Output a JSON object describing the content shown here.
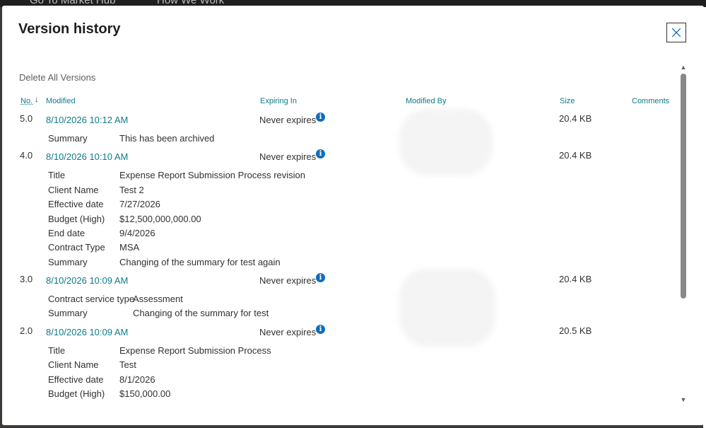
{
  "backdrop": {
    "nav1": "Go To Market Hub",
    "nav2": "How We Work"
  },
  "dialog": {
    "title": "Version history",
    "delete_all": "Delete All Versions",
    "columns": {
      "no": "No.",
      "modified": "Modified",
      "expiring": "Expiring In",
      "modified_by": "Modified By",
      "size": "Size",
      "comments": "Comments"
    },
    "versions": [
      {
        "no": "5.0",
        "modified": "8/10/2026 10:12 AM",
        "expires": "Never expires",
        "size": "20.4 KB",
        "fields": [
          {
            "label": "Summary",
            "value": "This has been archived"
          }
        ]
      },
      {
        "no": "4.0",
        "modified": "8/10/2026 10:10 AM",
        "expires": "Never expires",
        "size": "20.4 KB",
        "fields": [
          {
            "label": "Title",
            "value": "Expense Report Submission Process revision"
          },
          {
            "label": "Client Name",
            "value": "Test 2"
          },
          {
            "label": "Effective date",
            "value": "7/27/2026"
          },
          {
            "label": "Budget (High)",
            "value": "$12,500,000,000.00"
          },
          {
            "label": "End date",
            "value": "9/4/2026"
          },
          {
            "label": "Contract Type",
            "value": "MSA"
          },
          {
            "label": "Summary",
            "value": "Changing of the summary for test again"
          }
        ]
      },
      {
        "no": "3.0",
        "modified": "8/10/2026 10:09 AM",
        "expires": "Never expires",
        "size": "20.4 KB",
        "fields": [
          {
            "label": "Contract service type",
            "value": "Assessment"
          },
          {
            "label": "Summary",
            "value": "Changing of the summary for test"
          }
        ]
      },
      {
        "no": "2.0",
        "modified": "8/10/2026 10:09 AM",
        "expires": "Never expires",
        "size": "20.5 KB",
        "fields": [
          {
            "label": "Title",
            "value": "Expense Report Submission Process"
          },
          {
            "label": "Client Name",
            "value": "Test"
          },
          {
            "label": "Effective date",
            "value": "8/1/2026"
          },
          {
            "label": "Budget (High)",
            "value": "$150,000.00"
          }
        ]
      }
    ]
  },
  "icons": {
    "close": "close-icon",
    "info": "info-icon",
    "sort": "sort-descending-icon"
  },
  "colors": {
    "link": "#0f7b8a",
    "info": "#0f6cbd",
    "text": "#323130"
  }
}
